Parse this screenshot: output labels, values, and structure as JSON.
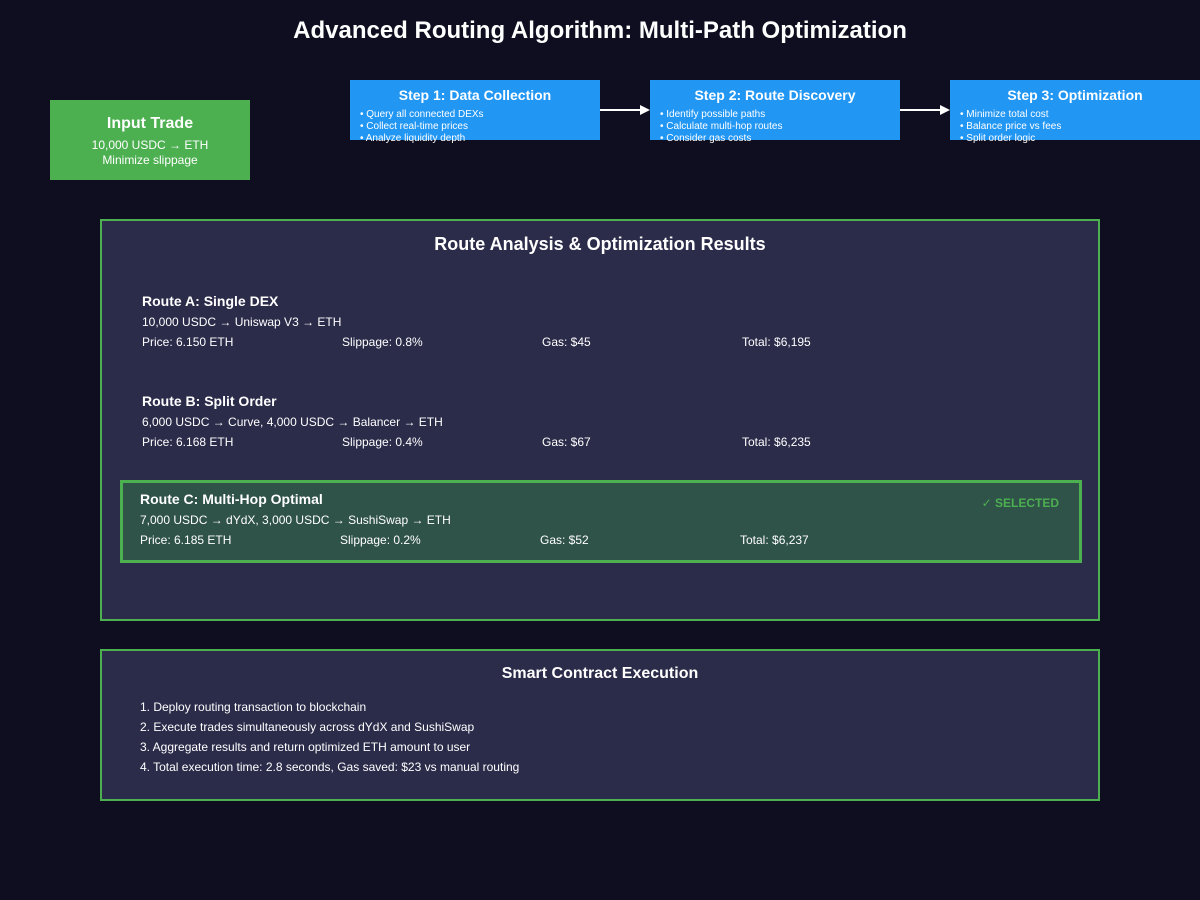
{
  "title": "Advanced Routing Algorithm: Multi-Path Optimization",
  "input": {
    "heading": "Input Trade",
    "line1": "10,000 USDC → ETH",
    "line2": "Minimize slippage"
  },
  "steps": [
    {
      "heading": "Step 1: Data Collection",
      "bullets": [
        "Query all connected DEXs",
        "Collect real-time prices",
        "Analyze liquidity depth"
      ]
    },
    {
      "heading": "Step 2: Route Discovery",
      "bullets": [
        "Identify possible paths",
        "Calculate multi-hop routes",
        "Consider gas costs"
      ]
    },
    {
      "heading": "Step 3: Optimization",
      "bullets": [
        "Minimize total cost",
        "Balance price vs fees",
        "Split order logic"
      ]
    }
  ],
  "colors": {
    "background": "#0e0e20",
    "green": "#4caf50",
    "blue": "#2196f3",
    "panel": "#2b2b4a",
    "selected": "#2f5249"
  },
  "analysis": {
    "title": "Route Analysis & Optimization Results",
    "routes": [
      {
        "name": "Route A: Single DEX",
        "path": "10,000 USDC → Uniswap V3 → ETH",
        "price": "Price: 6.150 ETH",
        "slippage": "Slippage: 0.8%",
        "gas": "Gas: $45",
        "total": "Total: $6,195",
        "selected": false
      },
      {
        "name": "Route B: Split Order",
        "path": "6,000 USDC → Curve, 4,000 USDC → Balancer → ETH",
        "price": "Price: 6.168 ETH",
        "slippage": "Slippage: 0.4%",
        "gas": "Gas: $67",
        "total": "Total: $6,235",
        "selected": false
      },
      {
        "name": "Route C: Multi-Hop Optimal",
        "path": "7,000 USDC → dYdX, 3,000 USDC → SushiSwap → ETH",
        "price": "Price: 6.185 ETH",
        "slippage": "Slippage: 0.2%",
        "gas": "Gas: $52",
        "total": "Total: $6,237",
        "selected": true,
        "badge": "✓ SELECTED"
      }
    ]
  },
  "execution": {
    "title": "Smart Contract Execution",
    "items": [
      "1. Deploy routing transaction to blockchain",
      "2. Execute trades simultaneously across dYdX and SushiSwap",
      "3. Aggregate results and return optimized ETH amount to user",
      "4. Total execution time: 2.8 seconds, Gas saved: $23 vs manual routing"
    ]
  }
}
